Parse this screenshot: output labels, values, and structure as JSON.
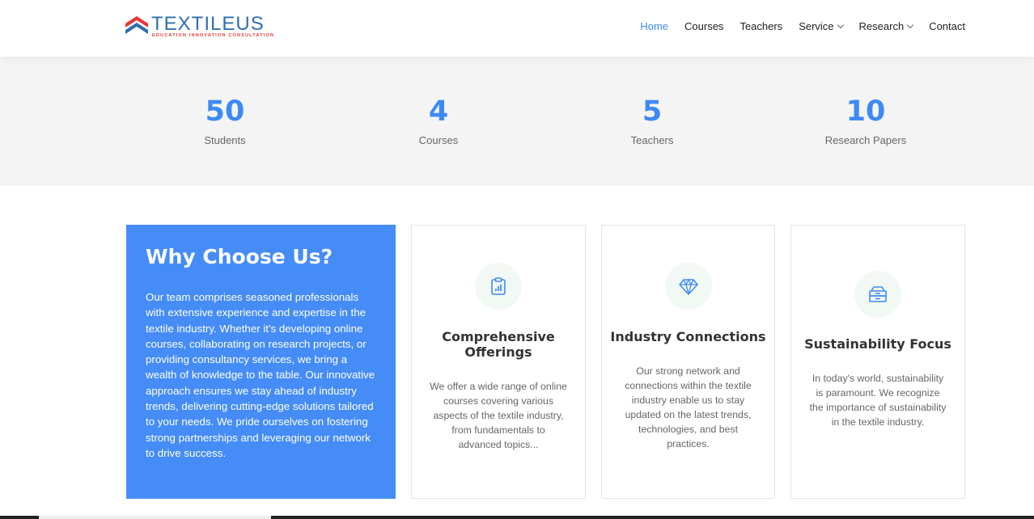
{
  "brand": {
    "name": "TEXTILEUS",
    "tagline": "EDUCATION INNOVATION CONSULTATION",
    "colors": {
      "primary": "#3d8af7",
      "logo_red": "#e53935",
      "logo_blue": "#2f6fb0"
    }
  },
  "nav": {
    "items": [
      {
        "label": "Home",
        "active": true
      },
      {
        "label": "Courses"
      },
      {
        "label": "Teachers"
      },
      {
        "label": "Service",
        "dropdown": true
      },
      {
        "label": "Research",
        "dropdown": true
      },
      {
        "label": "Contact"
      }
    ]
  },
  "stats": [
    {
      "value": "50",
      "label": "Students"
    },
    {
      "value": "4",
      "label": "Courses"
    },
    {
      "value": "5",
      "label": "Teachers"
    },
    {
      "value": "10",
      "label": "Research Papers"
    }
  ],
  "why": {
    "title": "Why Choose Us?",
    "text": "Our team comprises seasoned professionals with extensive experience and expertise in the textile industry. Whether it's developing online courses, collaborating on research projects, or providing consultancy services, we bring a wealth of knowledge to the table. Our innovative approach ensures we stay ahead of industry trends, delivering cutting-edge solutions tailored to your needs. We pride ourselves on fostering strong partnerships and leveraging our network to drive success."
  },
  "cards": [
    {
      "icon": "clipboard-chart-icon",
      "title": "Comprehensive Offerings",
      "text": "We offer a wide range of online courses covering various aspects of the textile industry, from fundamentals to advanced topics..."
    },
    {
      "icon": "diamond-icon",
      "title": "Industry Connections",
      "text": "Our strong network and connections within the textile industry enable us to stay updated on the latest trends, technologies, and best practices."
    },
    {
      "icon": "inbox-icon",
      "title": "Sustainability Focus",
      "text": "In today's world, sustainability is paramount. We recognize the importance of sustainability in the textile industry."
    }
  ]
}
